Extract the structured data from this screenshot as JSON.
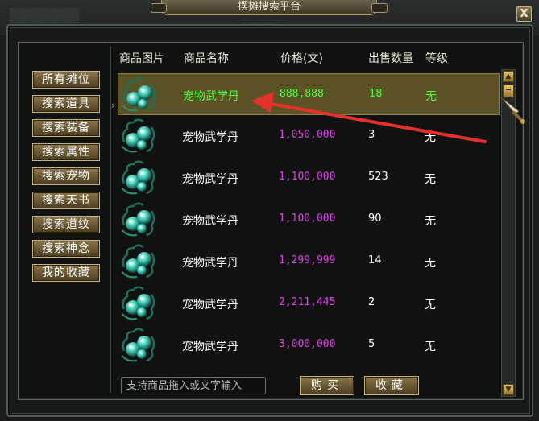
{
  "window": {
    "title": "摆摊搜索平台",
    "close_label": "X"
  },
  "sidebar": {
    "items": [
      {
        "label": "所有摊位"
      },
      {
        "label": "搜索道具"
      },
      {
        "label": "搜索装备"
      },
      {
        "label": "搜索属性"
      },
      {
        "label": "搜索宠物"
      },
      {
        "label": "搜索天书"
      },
      {
        "label": "搜索道纹"
      },
      {
        "label": "搜索神念"
      },
      {
        "label": "我的收藏"
      }
    ]
  },
  "table": {
    "columns": [
      "商品图片",
      "商品名称",
      "价格(文)",
      "出售数量",
      "等级"
    ],
    "rows": [
      {
        "name": "宠物武学丹",
        "price": "888,888",
        "qty": "18",
        "level": "无",
        "selected": true
      },
      {
        "name": "宠物武学丹",
        "price": "1,050,000",
        "qty": "3",
        "level": "无"
      },
      {
        "name": "宠物武学丹",
        "price": "1,100,000",
        "qty": "523",
        "level": "无"
      },
      {
        "name": "宠物武学丹",
        "price": "1,100,000",
        "qty": "90",
        "level": "无"
      },
      {
        "name": "宠物武学丹",
        "price": "1,299,999",
        "qty": "14",
        "level": "无"
      },
      {
        "name": "宠物武学丹",
        "price": "2,211,445",
        "qty": "2",
        "level": "无"
      },
      {
        "name": "宠物武学丹",
        "price": "3,000,000",
        "qty": "5",
        "level": "无"
      }
    ]
  },
  "footer": {
    "search_placeholder": "支持商品拖入或文字输入",
    "buy_label": "购买",
    "favorite_label": "收藏"
  },
  "colors": {
    "accent_gold": "#c9b27a",
    "price_magenta": "#e040e8",
    "selected_green": "#4cff3a",
    "annotation_red": "#e8302a"
  }
}
